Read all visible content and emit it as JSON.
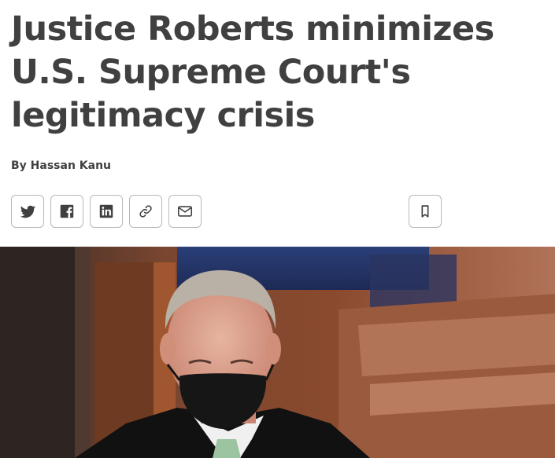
{
  "article": {
    "headline": "Justice Roberts minimizes U.S. Supreme Court's legitimacy crisis",
    "byline": "By Hassan Kanu"
  },
  "share_bar": {
    "buttons": [
      {
        "icon": "twitter-icon"
      },
      {
        "icon": "facebook-icon"
      },
      {
        "icon": "linkedin-icon"
      },
      {
        "icon": "link-icon"
      },
      {
        "icon": "email-icon"
      },
      {
        "icon": "bookmark-icon"
      }
    ]
  },
  "colors": {
    "headline_text": "#404040",
    "button_border": "#b8b8b8"
  }
}
